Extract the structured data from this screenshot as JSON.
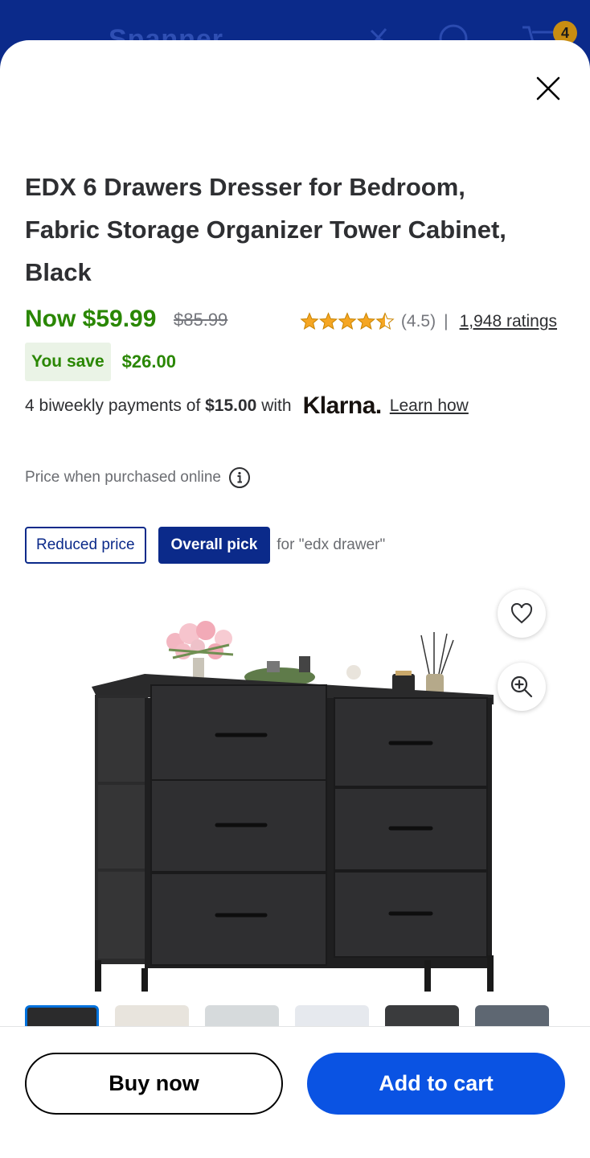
{
  "app_header": {
    "title": "Spanner",
    "cart_count": "4",
    "icons": [
      "back-arrow-icon",
      "no-delivery-icon",
      "help-icon",
      "cart-icon"
    ]
  },
  "product": {
    "title_lines": [
      "EDX 6 Drawers Dresser for Bedroom,",
      "Fabric Storage Organizer Tower Cabinet,",
      "Black"
    ],
    "price_now": "Now $59.99",
    "price_was": "$85.99",
    "rating_value": 4.5,
    "rating_text": "(4.5)",
    "rating_separator": "|",
    "ratings_count_link": "1,948 ratings",
    "you_save_label": "You save",
    "you_save_amount": "$26.00",
    "payments": {
      "prefix": "4 biweekly payments of",
      "amount": "$15.00",
      "suffix": "with",
      "provider": "Klarna.",
      "link": "Learn how"
    },
    "online_note": "Price when purchased online",
    "tags": {
      "reduced": "Reduced price",
      "pick": "Overall pick",
      "pick_for": "for \"edx drawer\""
    },
    "thumbnail_count": 6
  },
  "actions": {
    "buy_now": "Buy now",
    "add_to_cart": "Add to cart"
  },
  "colors": {
    "header_bg": "#0b2a8a",
    "price_green": "#2a8703",
    "primary_blue": "#0a53e3",
    "tag_navy": "#0b2a8a",
    "star_gold": "#f5a623"
  }
}
